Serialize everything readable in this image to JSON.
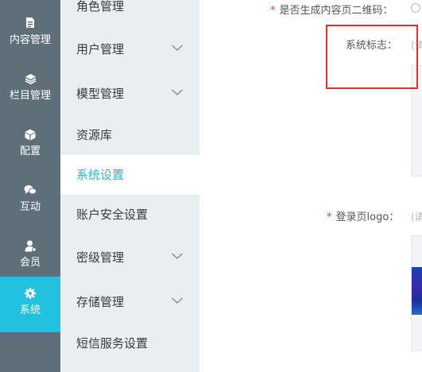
{
  "rail": {
    "items": [
      {
        "label": "内容管理",
        "icon": "document-icon",
        "active": false
      },
      {
        "label": "栏目管理",
        "icon": "layers-icon",
        "active": false
      },
      {
        "label": "配置",
        "icon": "cube-icon",
        "active": false
      },
      {
        "label": "互动",
        "icon": "chat-icon",
        "active": false
      },
      {
        "label": "会员",
        "icon": "user-icon",
        "active": false
      },
      {
        "label": "系统",
        "icon": "gear-icon",
        "active": true
      }
    ]
  },
  "submenu": {
    "items": [
      {
        "label": "角色管理",
        "has_arrow": false,
        "active": false
      },
      {
        "label": "用户管理",
        "has_arrow": true,
        "active": false
      },
      {
        "label": "模型管理",
        "has_arrow": true,
        "active": false
      },
      {
        "label": "资源库",
        "has_arrow": false,
        "active": false
      },
      {
        "label": "系统设置",
        "has_arrow": false,
        "active": true
      },
      {
        "label": "账户安全设置",
        "has_arrow": false,
        "active": false
      },
      {
        "label": "密级管理",
        "has_arrow": true,
        "active": false
      },
      {
        "label": "存储管理",
        "has_arrow": true,
        "active": false
      },
      {
        "label": "短信服务设置",
        "has_arrow": false,
        "active": false
      }
    ]
  },
  "form": {
    "qrcode_label": "是否生成内容页二维码：",
    "required_mark": "*",
    "logo_label": "系统标志：",
    "logo_hint": "(请",
    "login_logo_label": "登录页logo：",
    "login_logo_hint": "(请"
  },
  "colors": {
    "rail_bg": "#5e6f79",
    "rail_active": "#23c1e0",
    "submenu_bg": "#e9eef1",
    "submenu_active_text": "#23b7d9",
    "required": "#e0413b",
    "highlight_frame": "#e0302a"
  }
}
